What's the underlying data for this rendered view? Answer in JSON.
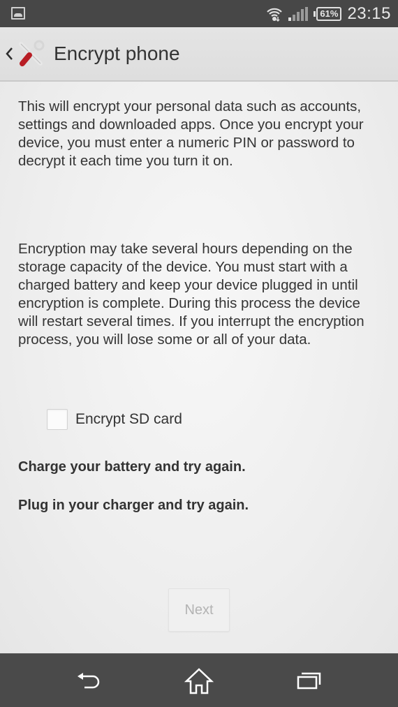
{
  "status_bar": {
    "notification_icon": "image-icon",
    "wifi_icon": "wifi-icon",
    "signal_icon": "signal-icon",
    "battery_level": "61%",
    "time": "23:15"
  },
  "action_bar": {
    "back_icon": "chevron-left-icon",
    "app_icon": "tools-icon",
    "title": "Encrypt phone"
  },
  "main": {
    "paragraph1": "This will encrypt your personal data such as accounts, settings and downloaded apps. Once you encrypt your device, you must enter a numeric PIN or password to decrypt it each time you turn it on.",
    "paragraph2": "Encryption may take several hours depending on the storage capacity of the device. You must start with a charged battery and keep your device plugged in until encryption is complete. During this process the device will restart several times. If you interrupt the encryption process, you will lose some or all of your data.",
    "encrypt_sd": {
      "label": "Encrypt SD card",
      "checked": false
    },
    "warning_battery": "Charge your battery and try again.",
    "warning_charger": "Plug in your charger and try again.",
    "next_label": "Next",
    "next_enabled": false
  },
  "nav_bar": {
    "back": "back-icon",
    "home": "home-icon",
    "recents": "recents-icon"
  }
}
